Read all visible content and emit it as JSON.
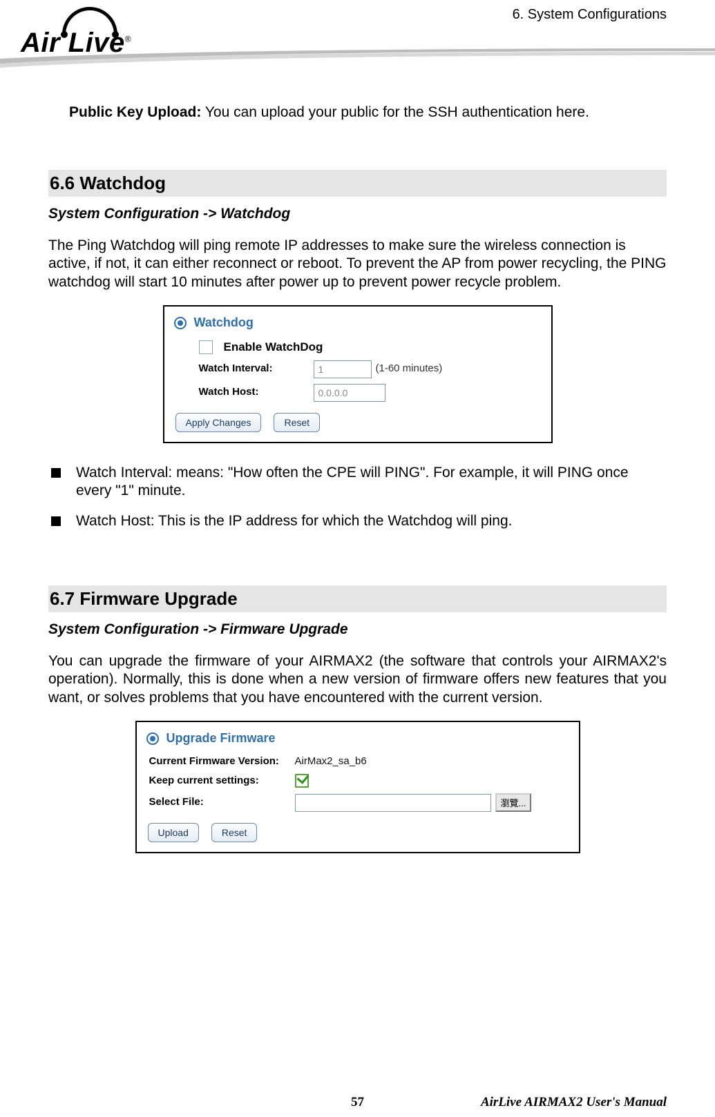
{
  "header": {
    "chapter": "6.  System Configurations",
    "logo_text": "Air Live",
    "logo_r": "®"
  },
  "intro": {
    "public_key_bold": "Public Key Upload:",
    "public_key_rest": " You can upload your public for the SSH authentication here."
  },
  "s66": {
    "title": "6.6 Watchdog",
    "path": "System Configuration -> Watchdog",
    "body": "The Ping Watchdog will ping remote IP addresses to make sure the wireless connection is active, if not, it can either reconnect or reboot.    To prevent the AP from power recycling, the PING watchdog will start 10 minutes after power up to prevent power recycle problem.",
    "panel": {
      "title": "Watchdog",
      "enable_label": "Enable WatchDog",
      "row1_label": "Watch Interval:",
      "row1_value": "1",
      "row1_unit": "(1-60 minutes)",
      "row2_label": "Watch Host:",
      "row2_value": "0.0.0.0",
      "btn_apply": "Apply Changes",
      "btn_reset": "Reset"
    },
    "bullets": {
      "b1_bold": "Watch Interval:",
      "b1_rest": "  means: \"How often the CPE will PING\".  For example, it will PING once every \"1\" minute.",
      "b2_bold": "Watch Host:",
      "b2_rest": " This is the IP address for which the Watchdog will ping."
    }
  },
  "s67": {
    "title": "6.7 Firmware Upgrade",
    "path": "System Configuration -> Firmware Upgrade",
    "body": "You can upgrade the firmware of your AIRMAX2 (the software that controls your AIRMAX2's operation). Normally, this is done when a new version of firmware offers new features that you want, or solves problems that you have encountered with the current version.",
    "panel": {
      "title": "Upgrade Firmware",
      "row1_label": "Current Firmware Version:",
      "row1_value": "AirMax2_sa_b6",
      "row2_label": "Keep current settings:",
      "row3_label": "Select File:",
      "browse": "瀏覽...",
      "btn_upload": "Upload",
      "btn_reset": "Reset"
    }
  },
  "footer": {
    "page": "57",
    "right": "AirLive AIRMAX2 User's Manual"
  }
}
